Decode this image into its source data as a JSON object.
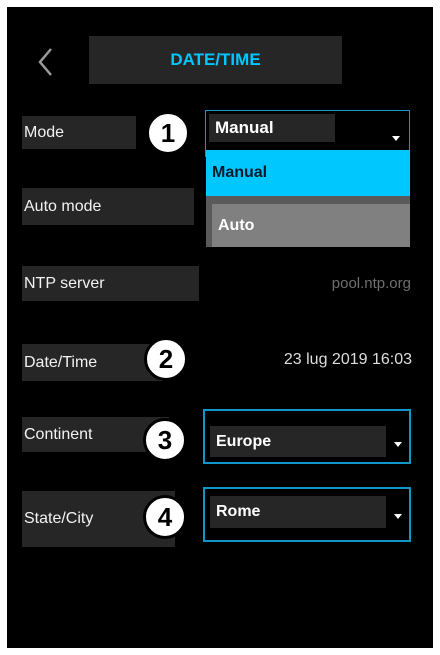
{
  "header": {
    "title": "DATE/TIME",
    "back_icon": "chevron-left-icon"
  },
  "mode": {
    "label": "Mode",
    "badge": "1",
    "selected": "Manual",
    "options": [
      "Manual",
      "Auto"
    ]
  },
  "auto_mode": {
    "label": "Auto mode"
  },
  "ntp": {
    "label": "NTP server",
    "value": "pool.ntp.org"
  },
  "datetime": {
    "label": "Date/Time",
    "badge": "2",
    "value": "23 lug 2019 16:03"
  },
  "continent": {
    "label": "Continent",
    "badge": "3",
    "selected": "Europe"
  },
  "city": {
    "label": "State/City",
    "badge": "4",
    "selected": "Rome"
  },
  "colors": {
    "accent": "#00c8ff",
    "border": "#1196c8",
    "option_highlight": "#00c8ff",
    "option_other": "#808080",
    "panel": "#262626",
    "background": "#000000"
  }
}
